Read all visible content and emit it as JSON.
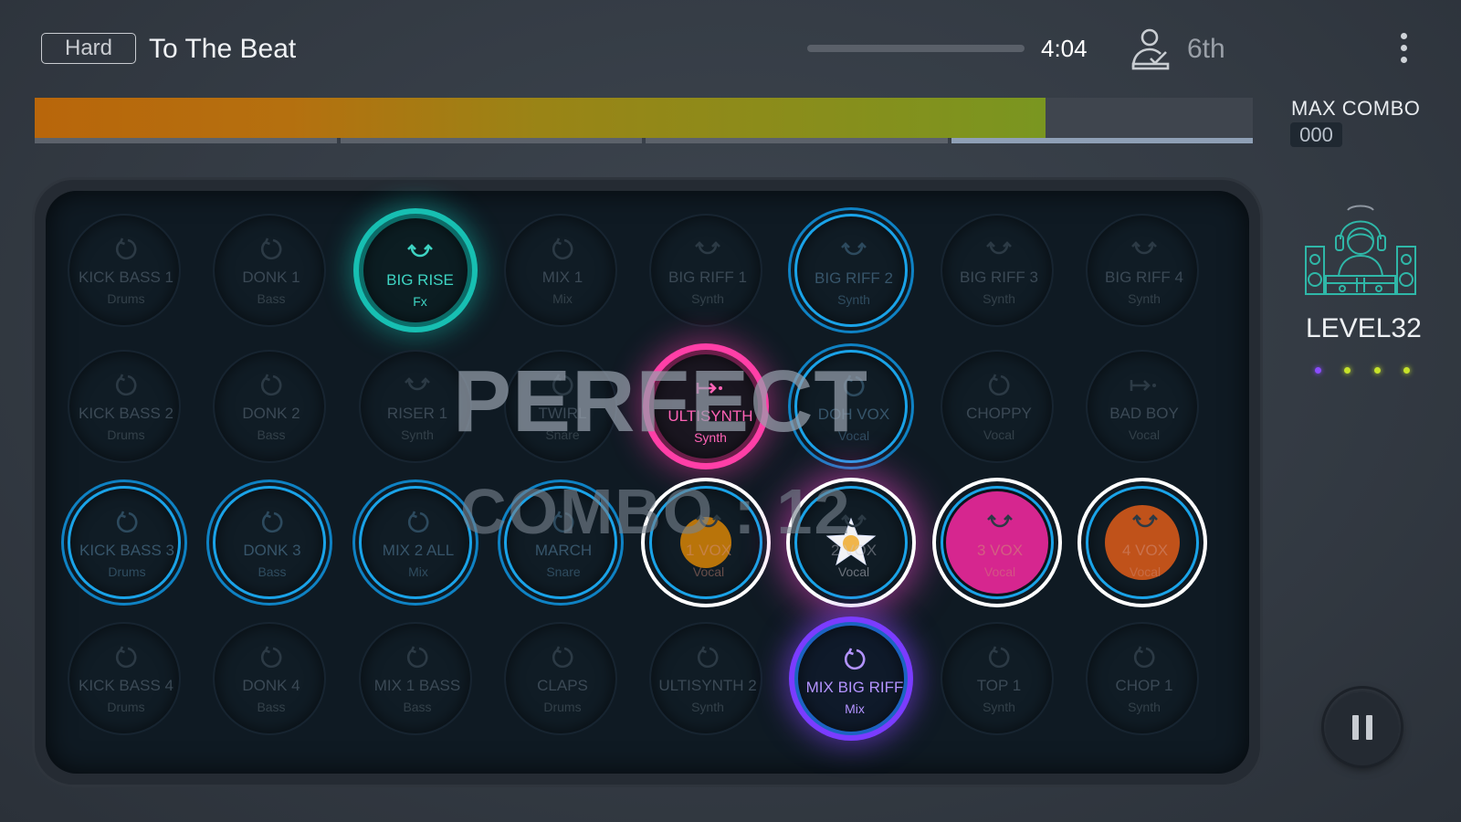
{
  "header": {
    "difficulty": "Hard",
    "song_title": "To The Beat",
    "time": "4:04",
    "rank": "6th",
    "song_progress": 0.0
  },
  "score": {
    "fill_fraction": 0.83,
    "max_combo_label": "MAX COMBO",
    "max_combo_value": "000"
  },
  "feedback": {
    "judgement": "PERFECT",
    "combo": "COMBO : 12"
  },
  "player": {
    "level": "LEVEL32",
    "dot_colors": [
      "#8a4cff",
      "#c6e22a",
      "#c6e22a",
      "#c6e22a"
    ]
  },
  "pads": [
    [
      {
        "name": "KICK BASS 1",
        "type": "Drums",
        "icon": "loop-icon",
        "state": "idle"
      },
      {
        "name": "DONK 1",
        "type": "Bass",
        "icon": "loop-icon",
        "state": "idle"
      },
      {
        "name": "BIG RISE",
        "type": "Fx",
        "icon": "oneshot-icon",
        "state": "teal"
      },
      {
        "name": "MIX 1",
        "type": "Mix",
        "icon": "loop-icon",
        "state": "idle"
      },
      {
        "name": "BIG RIFF 1",
        "type": "Synth",
        "icon": "oneshot-icon",
        "state": "idle"
      },
      {
        "name": "BIG RIFF 2",
        "type": "Synth",
        "icon": "oneshot-icon",
        "state": "blue"
      },
      {
        "name": "BIG RIFF 3",
        "type": "Synth",
        "icon": "oneshot-icon",
        "state": "idle"
      },
      {
        "name": "BIG RIFF 4",
        "type": "Synth",
        "icon": "oneshot-icon",
        "state": "idle"
      }
    ],
    [
      {
        "name": "KICK BASS 2",
        "type": "Drums",
        "icon": "loop-icon",
        "state": "idle"
      },
      {
        "name": "DONK 2",
        "type": "Bass",
        "icon": "loop-icon",
        "state": "idle"
      },
      {
        "name": "RISER 1",
        "type": "Synth",
        "icon": "oneshot-icon",
        "state": "idle"
      },
      {
        "name": "TWIRL",
        "type": "Snare",
        "icon": "loop-icon",
        "state": "idle"
      },
      {
        "name": "ULTISYNTH",
        "type": "Synth",
        "icon": "hold-icon",
        "state": "pink"
      },
      {
        "name": "DOH VOX",
        "type": "Vocal",
        "icon": "loop-icon",
        "state": "blue"
      },
      {
        "name": "CHOPPY",
        "type": "Vocal",
        "icon": "loop-icon",
        "state": "idle"
      },
      {
        "name": "BAD BOY",
        "type": "Vocal",
        "icon": "hold-icon",
        "state": "idle"
      }
    ],
    [
      {
        "name": "KICK BASS 3",
        "type": "Drums",
        "icon": "loop-icon",
        "state": "blue"
      },
      {
        "name": "DONK 3",
        "type": "Bass",
        "icon": "loop-icon",
        "state": "blue"
      },
      {
        "name": "MIX 2 ALL",
        "type": "Mix",
        "icon": "loop-icon",
        "state": "blue"
      },
      {
        "name": "MARCH",
        "type": "Snare",
        "icon": "loop-icon",
        "state": "blue"
      },
      {
        "name": "1 VOX",
        "type": "Vocal",
        "icon": "oneshot-icon",
        "state": "note-small",
        "note_color": "#b9740a"
      },
      {
        "name": "2 VOX",
        "type": "Vocal",
        "icon": "oneshot-icon",
        "state": "star"
      },
      {
        "name": "3 VOX",
        "type": "Vocal",
        "icon": "oneshot-icon",
        "state": "note-full",
        "note_color": "#d6268f"
      },
      {
        "name": "4 VOX",
        "type": "Vocal",
        "icon": "oneshot-icon",
        "state": "note-large",
        "note_color": "#c0521a"
      }
    ],
    [
      {
        "name": "KICK BASS 4",
        "type": "Drums",
        "icon": "loop-icon",
        "state": "idle"
      },
      {
        "name": "DONK 4",
        "type": "Bass",
        "icon": "loop-icon",
        "state": "idle"
      },
      {
        "name": "MIX 1 BASS",
        "type": "Bass",
        "icon": "loop-icon",
        "state": "idle"
      },
      {
        "name": "CLAPS",
        "type": "Drums",
        "icon": "loop-icon",
        "state": "idle"
      },
      {
        "name": "ULTISYNTH 2",
        "type": "Synth",
        "icon": "loop-icon",
        "state": "idle"
      },
      {
        "name": "MIX BIG RIFF",
        "type": "Mix",
        "icon": "loop-icon",
        "state": "purple"
      },
      {
        "name": "TOP 1",
        "type": "Synth",
        "icon": "loop-icon",
        "state": "idle"
      },
      {
        "name": "CHOP 1",
        "type": "Synth",
        "icon": "loop-icon",
        "state": "idle"
      }
    ]
  ]
}
